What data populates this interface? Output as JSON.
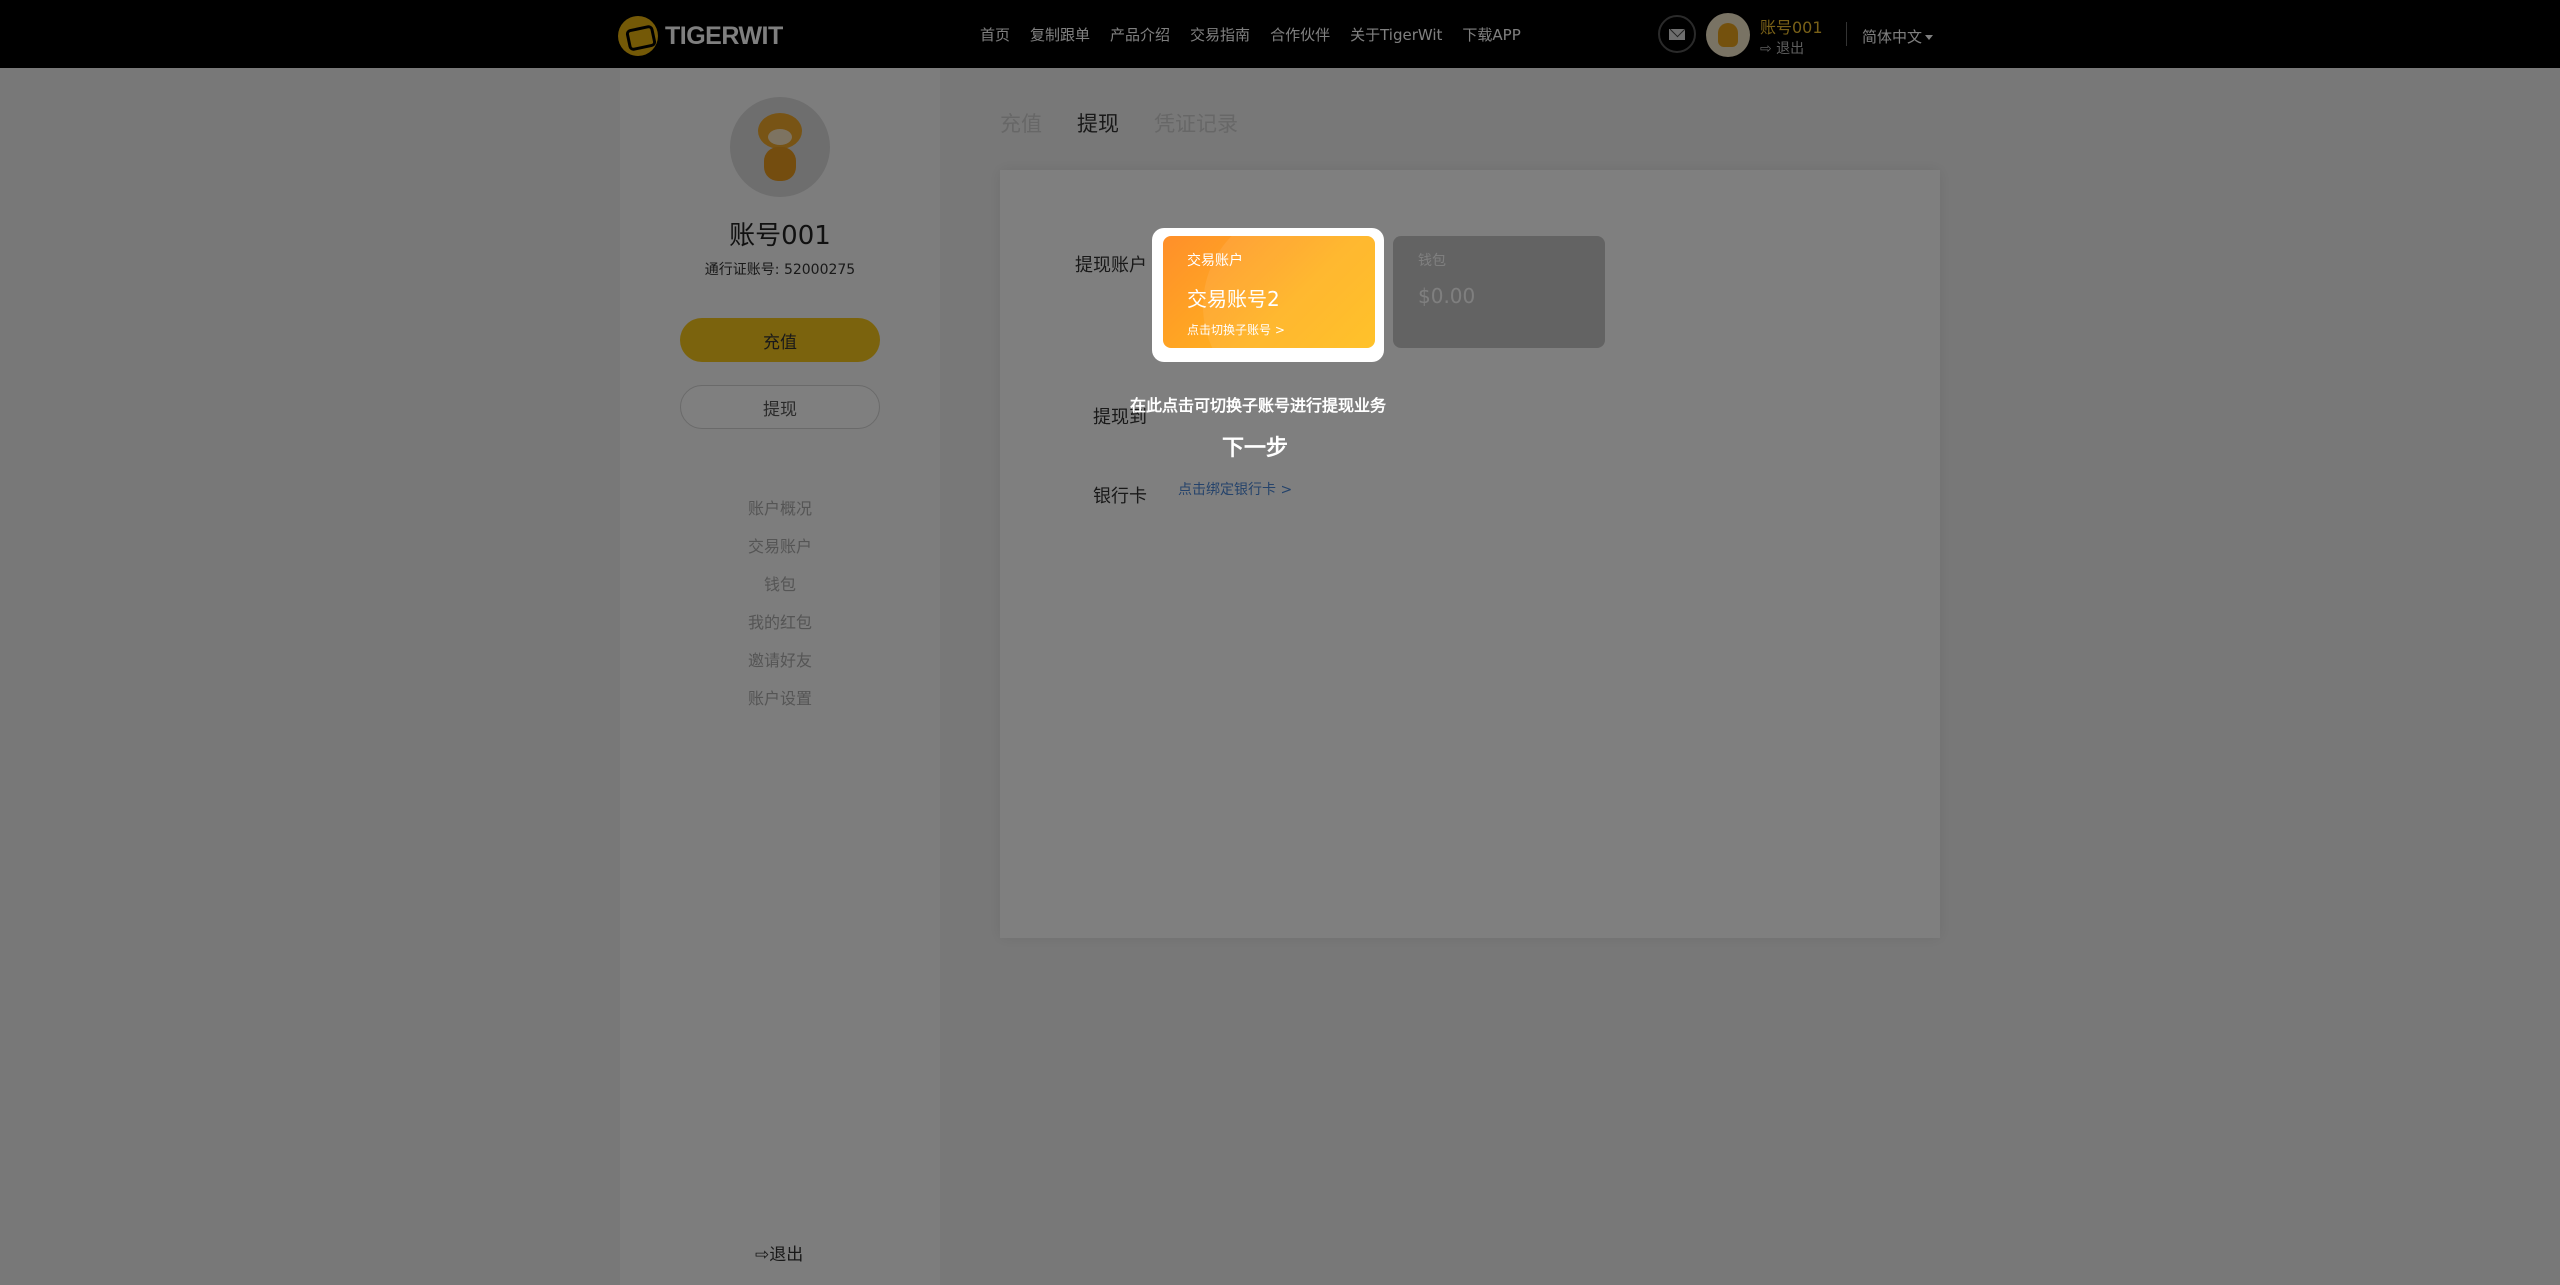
{
  "header": {
    "logo_text": "TIGERWIT",
    "nav": [
      "首页",
      "复制跟单",
      "产品介绍",
      "交易指南",
      "合作伙伴",
      "关于TigerWit",
      "下载APP"
    ],
    "username": "账号001",
    "logout": "⇨ 退出",
    "language": "简体中文"
  },
  "sidebar": {
    "name": "账号001",
    "pass_label": "通行证账号:",
    "pass_number": "52000275",
    "deposit_button": "充值",
    "withdraw_button": "提现",
    "menu": [
      "账户概况",
      "交易账户",
      "钱包",
      "我的红包",
      "邀请好友",
      "账户设置"
    ],
    "logout": "⇨退出"
  },
  "main": {
    "tabs": [
      "充值",
      "提现",
      "凭证记录"
    ],
    "active_tab": "提现",
    "withdraw_account_label": "提现账户",
    "withdraw_to_label": "提现到",
    "bank_card_label": "银行卡",
    "bank_card_link": "点击绑定银行卡 >",
    "trading_card": {
      "label": "交易账户",
      "name": "交易账号2",
      "switch": "点击切换子账号 >"
    },
    "wallet_card": {
      "label": "钱包",
      "balance": "$0.00"
    }
  },
  "overlay": {
    "tip": "在此点击可切换子账号进行提现业务",
    "next": "下一步"
  },
  "colors": {
    "accent": "#f6c61b",
    "card_gradient_start": "#ff8f2a",
    "card_gradient_end": "#ffbd18",
    "link": "#4a86d6"
  }
}
